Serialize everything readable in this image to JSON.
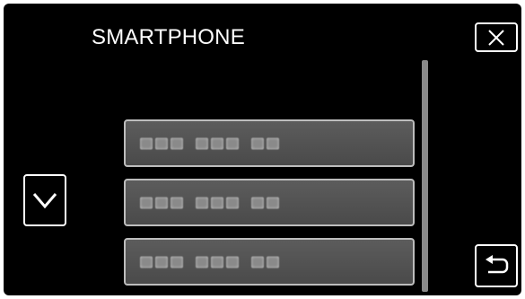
{
  "header": {
    "title": "SMARTPHONE"
  },
  "buttons": {
    "close_icon": "close-icon",
    "down_icon": "chevron-down-icon",
    "back_icon": "return-arrow-icon"
  },
  "list": {
    "items": [
      {
        "label": "",
        "masked_groups": [
          3,
          3,
          2
        ]
      },
      {
        "label": "",
        "masked_groups": [
          3,
          3,
          2
        ]
      },
      {
        "label": "",
        "masked_groups": [
          3,
          3,
          2
        ]
      }
    ]
  },
  "colors": {
    "background": "#000000",
    "foreground": "#ffffff",
    "item_fill": "#555555",
    "item_border": "#bdbdbd",
    "scrollbar": "#8a8a8a"
  }
}
